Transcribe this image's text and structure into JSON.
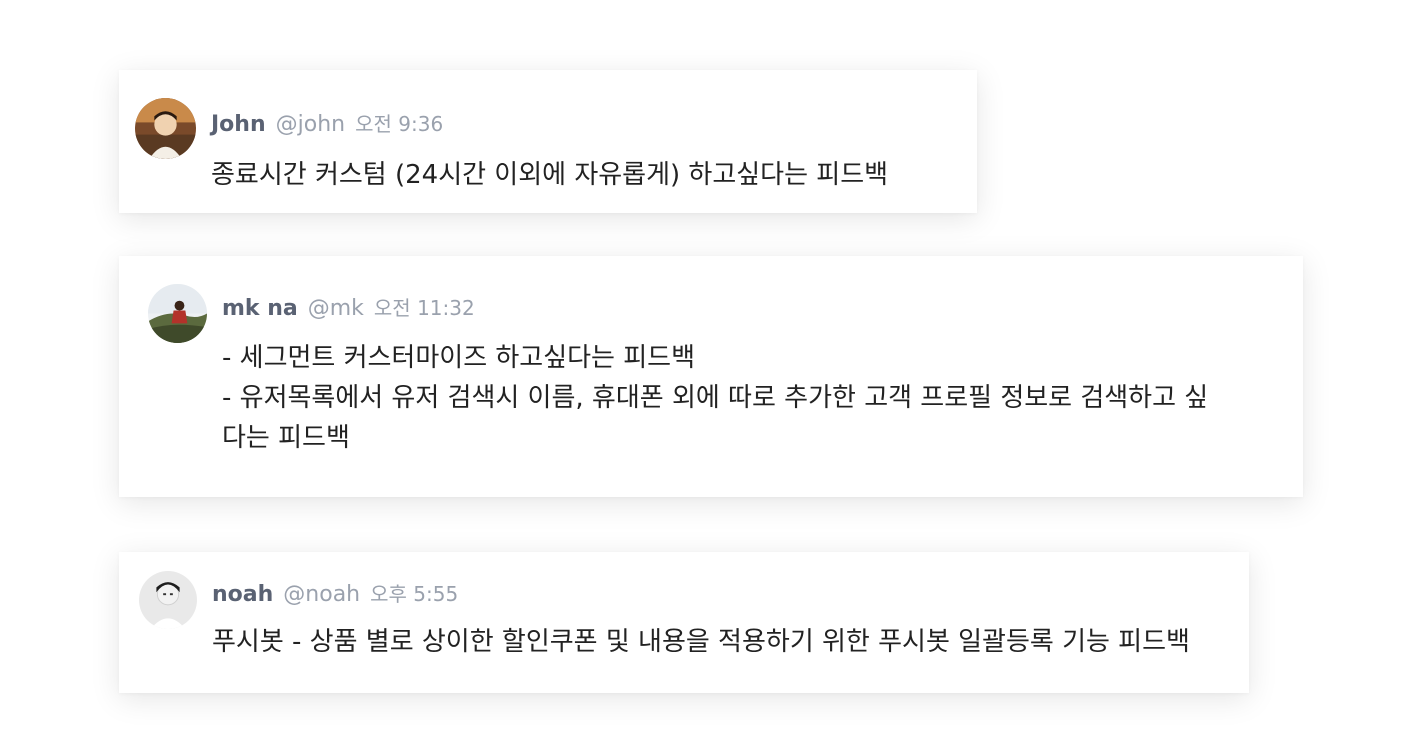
{
  "messages": [
    {
      "name": "John",
      "handle": "@john",
      "time": "오전 9:36",
      "lines": [
        "종료시간 커스텀 (24시간 이외에 자유롭게) 하고싶다는 피드백"
      ]
    },
    {
      "name": "mk na",
      "handle": "@mk",
      "time": "오전 11:32",
      "lines": [
        "- 세그먼트 커스터마이즈 하고싶다는 피드백",
        "- 유저목록에서 유저 검색시 이름, 휴대폰 외에 따로 추가한 고객 프로필 정보로 검색하고 싶",
        "다는 피드백"
      ]
    },
    {
      "name": "noah",
      "handle": "@noah",
      "time": "오후 5:55",
      "lines": [
        "푸시봇 - 상품 별로 상이한 할인쿠폰 및 내용을 적용하기 위한 푸시봇 일괄등록 기능 피드백"
      ]
    }
  ],
  "colors": {
    "name": "#5a6273",
    "muted": "#9aa1ad",
    "text": "#222222"
  }
}
